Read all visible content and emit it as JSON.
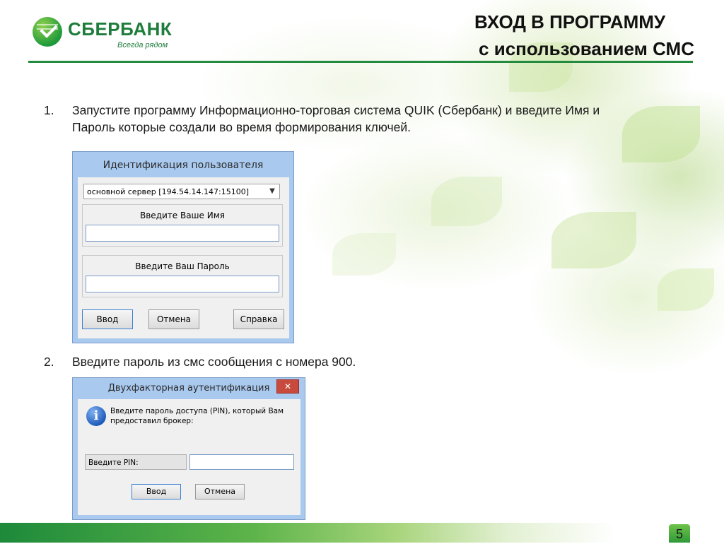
{
  "header": {
    "brand_name": "СБЕРБАНК",
    "brand_tagline": "Всегда рядом",
    "title_line1": "ВХОД В ПРОГРАММУ",
    "title_line2": "с использованием СМС"
  },
  "steps": [
    {
      "number": "1.",
      "text": "Запустите программу Информационно-торговая система QUIK (Сбербанк) и введите Имя и Пароль которые создали во время формирования ключей."
    },
    {
      "number": "2.",
      "text": "Введите пароль из смс сообщения с номера 900."
    }
  ],
  "login_dialog": {
    "title": "Идентификация пользователя",
    "server_selected": "основной сервер [194.54.14.147:15100]",
    "name_label": "Введите Ваше Имя",
    "name_value": "",
    "password_label": "Введите Ваш Пароль",
    "password_value": "",
    "buttons": {
      "ok": "Ввод",
      "cancel": "Отмена",
      "help": "Справка"
    }
  },
  "twofa_dialog": {
    "title": "Двухфакторная аутентификация",
    "close_glyph": "✕",
    "message": "Введите пароль доступа (PIN), который Вам предоставил брокер:",
    "pin_label": "Введите PIN:",
    "pin_value": "",
    "buttons": {
      "ok": "Ввод",
      "cancel": "Отмена"
    }
  },
  "footer": {
    "page_number": "5"
  },
  "icons": {
    "logo": "sberbank-logo-icon",
    "info": "info-icon",
    "dropdown": "chevron-down-icon",
    "close": "close-icon"
  },
  "colors": {
    "brand_green": "#238a3e",
    "dialog_frame": "#a9c9ee"
  }
}
